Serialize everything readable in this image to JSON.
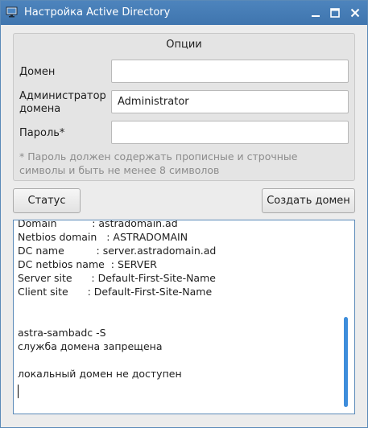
{
  "window": {
    "title": "Настройка Active Directory"
  },
  "options": {
    "group_title": "Опции",
    "domain_label": "Домен",
    "domain_value": "",
    "admin_label_line1": "Администратор",
    "admin_label_line2": "домена",
    "admin_value": "Administrator",
    "password_label": "Пароль*",
    "password_value": "",
    "note_line1": "* Пароль должен содержать прописные и строчные",
    "note_line2": "символы и быть не менее 8 символов"
  },
  "buttons": {
    "status_label": "Статус",
    "create_domain_label": "Создать домен"
  },
  "output": {
    "lines": [
      "Domain           : astradomain.ad",
      "Netbios domain   : ASTRADOMAIN",
      "DC name          : server.astradomain.ad",
      "DC netbios name  : SERVER",
      "Server site      : Default-First-Site-Name",
      "Client site      : Default-First-Site-Name",
      "",
      "",
      "astra-sambadc -S",
      "служба домена запрещена",
      "",
      "локальный домен не доступен"
    ],
    "scroll_position": 0.5
  },
  "colors": {
    "titlebar": "#4579b2",
    "accent": "#3e8ddb",
    "window_bg": "#ececec"
  },
  "icons": [
    "app-monitor-icon",
    "minimize-icon",
    "maximize-icon",
    "close-icon"
  ]
}
